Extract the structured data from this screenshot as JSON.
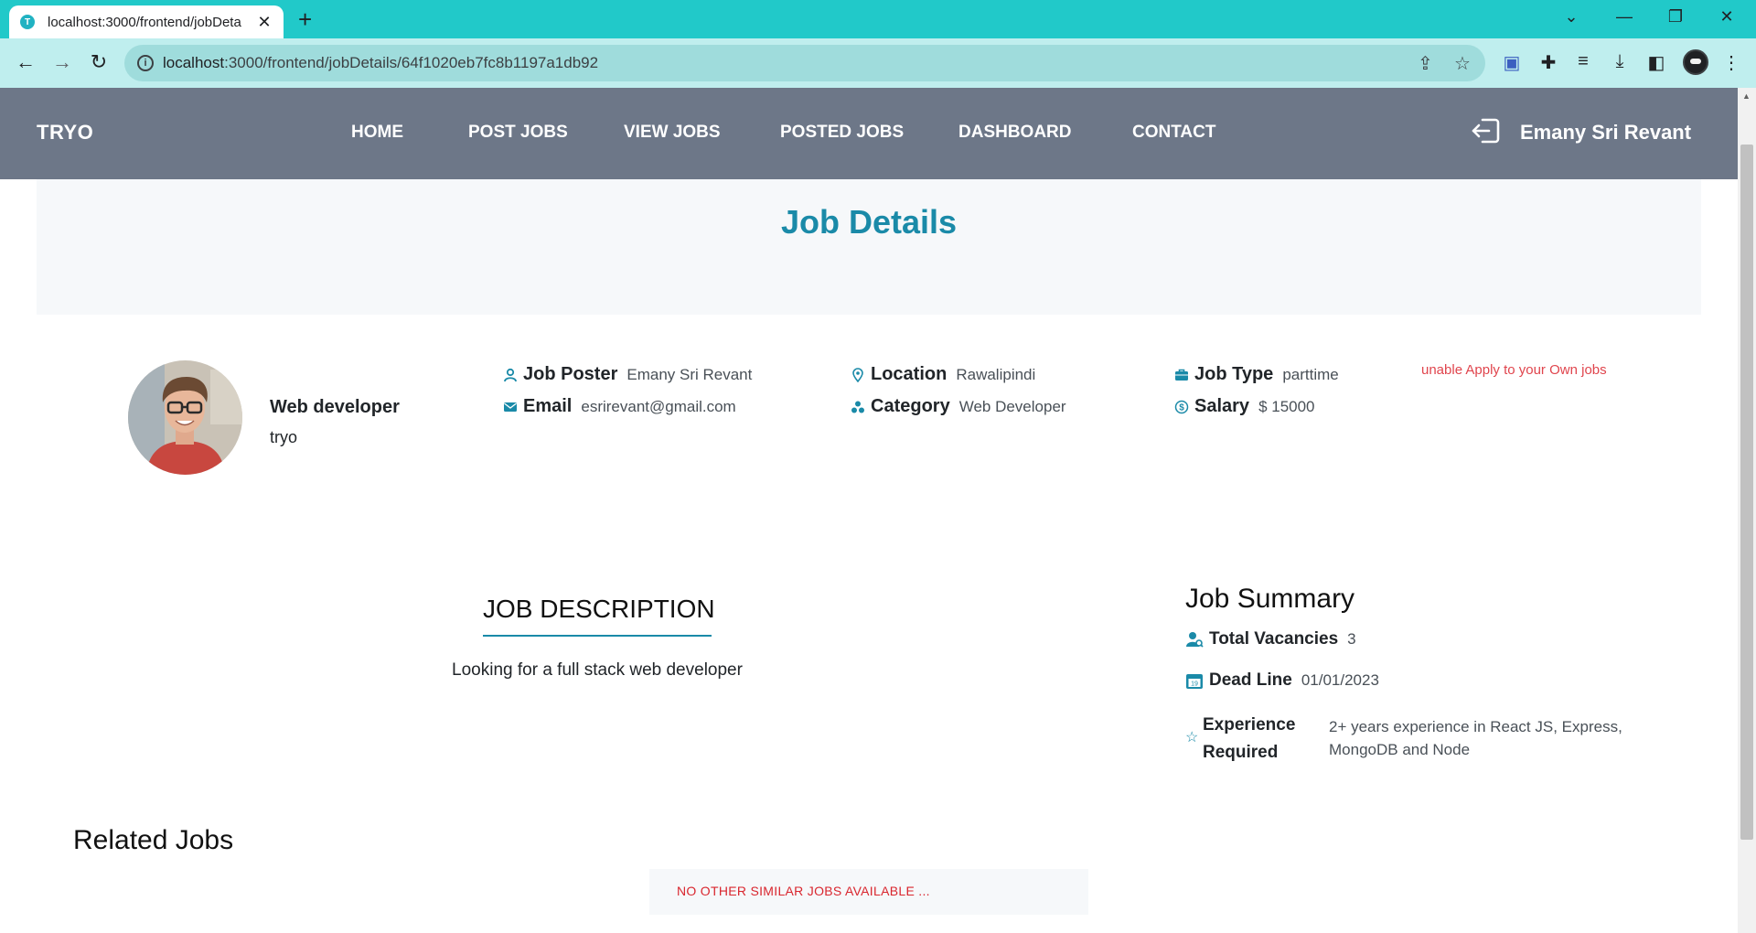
{
  "browser": {
    "tab_title": "localhost:3000/frontend/jobDeta",
    "tab_favicon_letter": "T",
    "url_host": "localhost",
    "url_path": ":3000/frontend/jobDetails/64f1020eb7fc8b1197a1db92"
  },
  "navbar": {
    "brand": "TRYO",
    "links": [
      "HOME",
      "POST JOBS",
      "VIEW JOBS",
      "POSTED JOBS",
      "DASHBOARD",
      "CONTACT"
    ],
    "user_name": "Emany Sri Revant"
  },
  "hero": {
    "title": "Job Details"
  },
  "job": {
    "title": "Web developer",
    "company": "tryo",
    "poster_label": "Job Poster",
    "poster_value": "Emany Sri Revant",
    "email_label": "Email",
    "email_value": "esrirevant@gmail.com",
    "location_label": "Location",
    "location_value": "Rawalipindi",
    "category_label": "Category",
    "category_value": "Web Developer",
    "type_label": "Job Type",
    "type_value": "parttime",
    "salary_label": "Salary",
    "salary_value": "$ 15000",
    "apply_note": "unable Apply to your Own jobs"
  },
  "description": {
    "heading": "JOB DESCRIPTION",
    "text": "Looking for a full stack web developer"
  },
  "summary": {
    "heading": "Job Summary",
    "vacancies_label": "Total Vacancies",
    "vacancies_value": "3",
    "deadline_label": "Dead Line",
    "deadline_value": "01/01/2023",
    "experience_label": "Experience Required",
    "experience_value": "2+ years experience in React JS, Express, MongoDB and Node"
  },
  "related": {
    "heading": "Related Jobs",
    "empty_message": "NO OTHER SIMILAR JOBS AVAILABLE ..."
  },
  "colors": {
    "tab_strip": "#21c9c9",
    "navbar": "#6d7788",
    "accent": "#1a8aa8",
    "warning_text": "#e0454d"
  },
  "icons": [
    "user-icon",
    "mail-icon",
    "map-pin-icon",
    "category-icon",
    "briefcase-icon",
    "dollar-icon",
    "calendar-icon",
    "star-icon",
    "logout-icon"
  ]
}
